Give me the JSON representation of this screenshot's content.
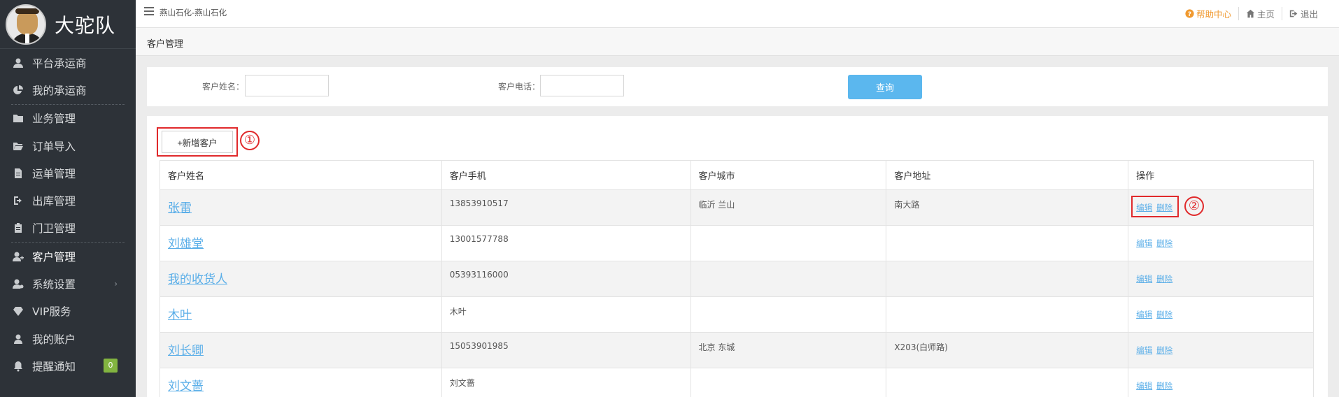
{
  "sidebar": {
    "brand": "大驼队",
    "items": [
      {
        "label": "平台承运商",
        "icon": "user-icon"
      },
      {
        "label": "我的承运商",
        "icon": "pie-chart-icon"
      },
      {
        "label": "业务管理",
        "icon": "folder-icon"
      },
      {
        "label": "订单导入",
        "icon": "folder-open-icon"
      },
      {
        "label": "运单管理",
        "icon": "document-icon"
      },
      {
        "label": "出库管理",
        "icon": "sign-out-icon"
      },
      {
        "label": "门卫管理",
        "icon": "clipboard-icon"
      },
      {
        "label": "客户管理",
        "icon": "user-plus-icon",
        "active": true
      },
      {
        "label": "系统设置",
        "icon": "user-settings-icon",
        "arrow": "›"
      },
      {
        "label": "VIP服务",
        "icon": "diamond-icon"
      },
      {
        "label": "我的账户",
        "icon": "user-icon"
      },
      {
        "label": "提醒通知",
        "icon": "bell-icon",
        "badge": "0"
      }
    ]
  },
  "topbar": {
    "company": "燕山石化-燕山石化",
    "help": "帮助中心",
    "home": "主页",
    "logout": "退出"
  },
  "breadcrumb": "客户管理",
  "search": {
    "name_label": "客户姓名：",
    "name_value": "",
    "phone_label": "客户电话：",
    "phone_value": "",
    "query_button": "查询"
  },
  "toolbar": {
    "add_button": "+新增客户"
  },
  "annotations": {
    "one": "①",
    "two": "②"
  },
  "table": {
    "headers": [
      "客户姓名",
      "客户手机",
      "客户城市",
      "客户地址",
      "操作"
    ],
    "edit_label": "编辑",
    "delete_label": "删除",
    "rows": [
      {
        "name": "张雷",
        "phone": "13853910517",
        "city": "临沂 兰山",
        "address": "南大路"
      },
      {
        "name": "刘雄堂",
        "phone": "13001577788",
        "city": "",
        "address": ""
      },
      {
        "name": "我的收货人",
        "phone": "05393116000",
        "city": "",
        "address": ""
      },
      {
        "name": "木叶",
        "phone": "木叶",
        "city": "",
        "address": ""
      },
      {
        "name": "刘长卿",
        "phone": "15053901985",
        "city": "北京 东城",
        "address": "X203(白师路)"
      },
      {
        "name": "刘文蔷",
        "phone": "刘文蔷",
        "city": "",
        "address": ""
      }
    ]
  },
  "colors": {
    "sidebar_bg": "#2d3238",
    "accent_blue": "#5bb7ee",
    "link_blue": "#5aaee8",
    "annotation_red": "#e0292b",
    "help_orange": "#f0992f",
    "badge_green": "#82b440"
  }
}
